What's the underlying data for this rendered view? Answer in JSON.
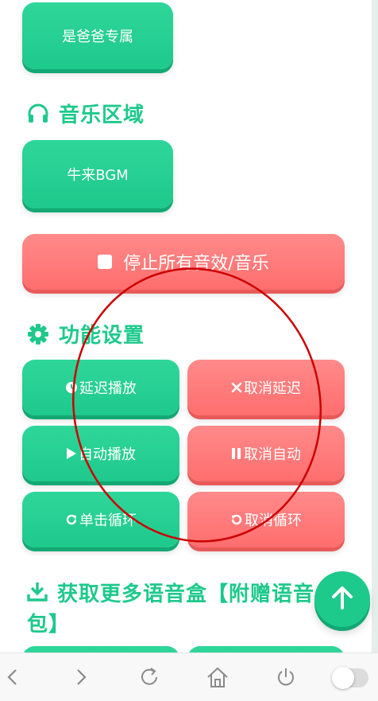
{
  "buttons": {
    "dad": "是爸爸专属",
    "bgm": "牛来BGM",
    "stop_all": "停止所有音效/音乐",
    "delay_play": "延迟播放",
    "cancel_delay": "取消延迟",
    "auto_play": "自动播放",
    "cancel_auto": "取消自动",
    "single_loop": "单击循环",
    "cancel_loop": "取消循环"
  },
  "sections": {
    "music": "音乐区域",
    "settings": "功能设置",
    "more_line1": "获取更多语音盒【附赠语音",
    "more_line2": "包】"
  },
  "icons": {
    "music": "headphones-icon",
    "settings": "gear-icon",
    "more": "download-icon",
    "stop": "stop-square-icon",
    "delay": "clock-icon",
    "cancel_delay": "close-icon",
    "auto_play": "play-icon",
    "cancel_auto": "pause-icon",
    "loop": "redo-icon",
    "cancel_loop": "undo-icon",
    "fab": "arrow-up-icon"
  },
  "colors": {
    "green": "#1ec98c",
    "red": "#ff7a7a",
    "annotation": "#cc0000"
  }
}
